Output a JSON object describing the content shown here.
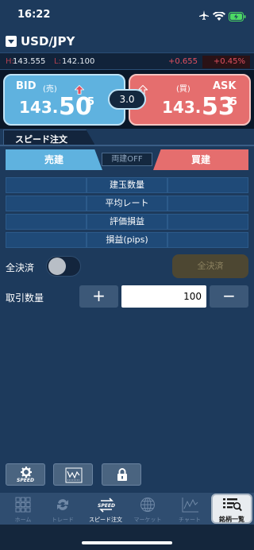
{
  "status_bar": {
    "time": "16:22"
  },
  "symbol": {
    "name": "USD/JPY"
  },
  "stats": {
    "high_label": "H:",
    "high_value": "143.555",
    "low_label": "L:",
    "low_value": "142.100",
    "change": "+0.655",
    "change_pct": "+0.45%"
  },
  "bid": {
    "label": "BID",
    "sub": "(売)",
    "price_main": "143.",
    "price_big": "50",
    "price_sub": "5"
  },
  "ask": {
    "label": "ASK",
    "sub": "(買)",
    "price_main": "143.",
    "price_big": "53",
    "price_sub": "5"
  },
  "spread": "3.0",
  "speed_tab": "スピード注文",
  "order": {
    "sell_label": "売建",
    "hedge_label": "両建OFF",
    "buy_label": "買建"
  },
  "position_info": [
    "建玉数量",
    "平均レート",
    "評価損益",
    "損益(pips)"
  ],
  "close_all": {
    "label": "全決済",
    "button": "全決済",
    "toggle_on": false
  },
  "quantity": {
    "label": "取引数量",
    "value": "100",
    "plus": "+",
    "minus": "−"
  },
  "tools": {
    "speed_label": "SPEED"
  },
  "tab_bar": {
    "home": "ホーム",
    "trade": "トレード",
    "speed": "スピード注文",
    "market": "マーケット",
    "chart": "チャート",
    "symbols": "銘柄一覧"
  },
  "colors": {
    "background": "#1d3a5c",
    "bid": "#5fb2df",
    "ask": "#e56e6e",
    "change": "#e2505f"
  },
  "icons": {
    "airplane": "airplane-icon",
    "wifi": "wifi-icon",
    "battery": "battery-charging-icon",
    "bid_arrow": "up-arrow-icon",
    "ask_arrow": "up-arrow-icon",
    "speed_settings": "gear-icon",
    "chart_tool": "chart-icon",
    "lock": "lock-icon"
  }
}
